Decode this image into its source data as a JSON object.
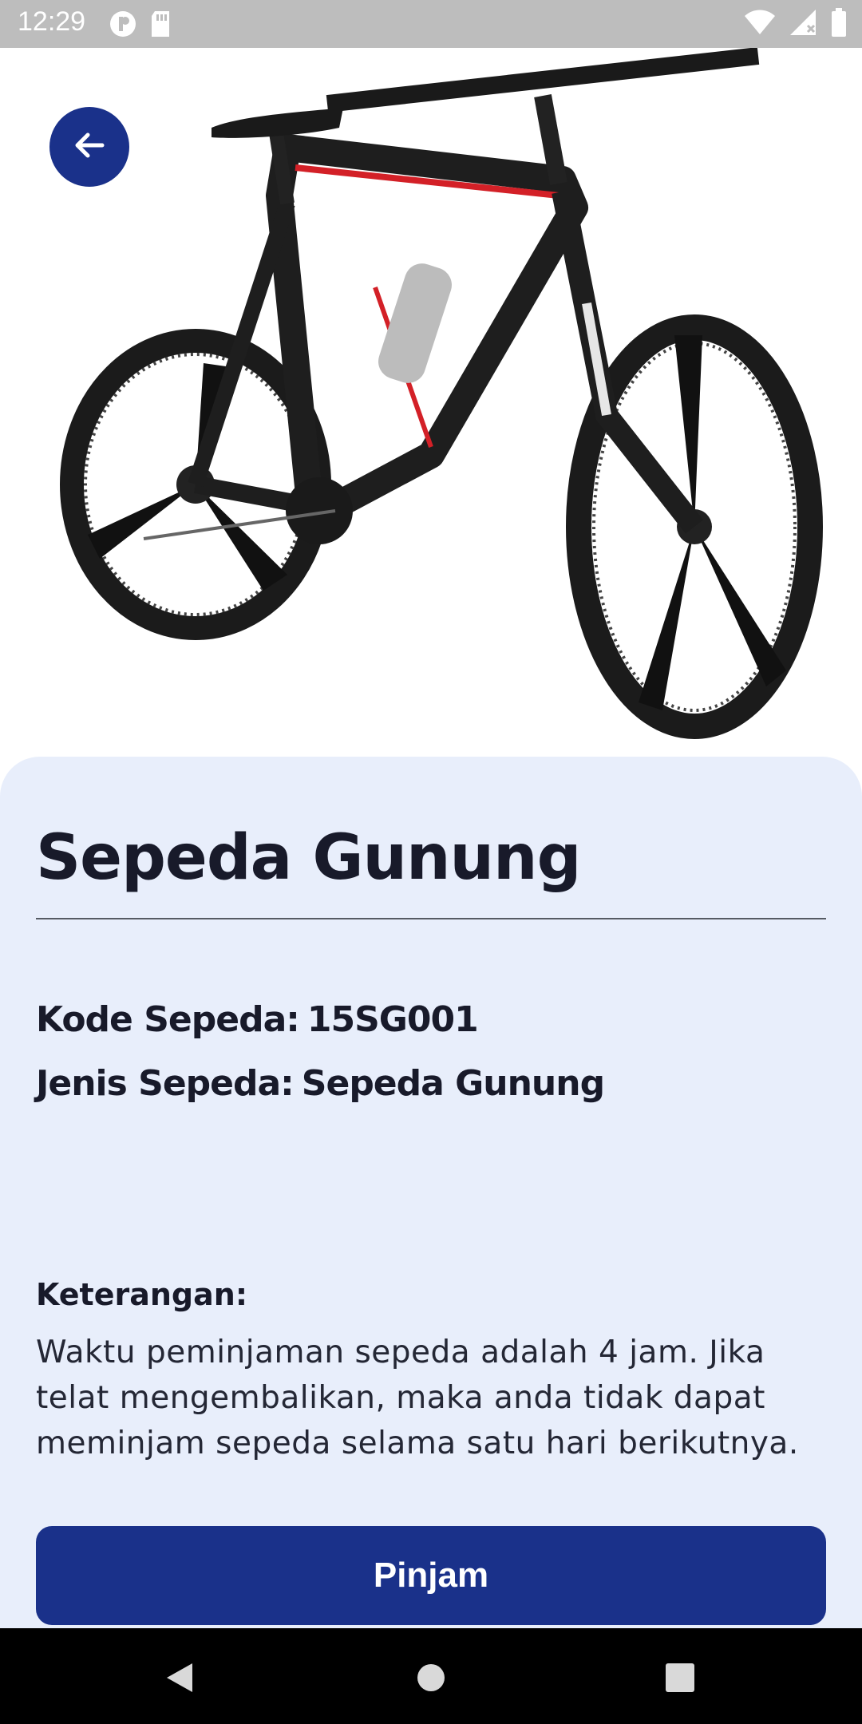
{
  "status_bar": {
    "time": "12:29",
    "left_icons": [
      "notification-icon",
      "sd-card-icon"
    ],
    "right_icons": [
      "wifi-icon",
      "signal-icon",
      "battery-icon"
    ]
  },
  "hero": {
    "image_description_icon": "bicycle-image",
    "back_icon": "arrow-left-icon"
  },
  "details": {
    "title": "Sepeda Gunung",
    "code_label": "Kode Sepeda:",
    "code_value": "15SG001",
    "type_label": "Jenis Sepeda:",
    "type_value": "Sepeda Gunung",
    "note_label": "Keterangan:",
    "note_text": "Waktu peminjaman sepeda adalah 4 jam. Jika telat mengembalikan, maka anda tidak dapat meminjam sepeda selama satu hari berikutnya.",
    "button_label": "Pinjam"
  },
  "nav_bar": {
    "icons": [
      "back-triangle-icon",
      "home-circle-icon",
      "recents-square-icon"
    ]
  },
  "colors": {
    "accent": "#1a318a",
    "sheet_background": "#e8eefb",
    "status_bar": "#bdbdbd",
    "text_dark": "#181a2a"
  }
}
